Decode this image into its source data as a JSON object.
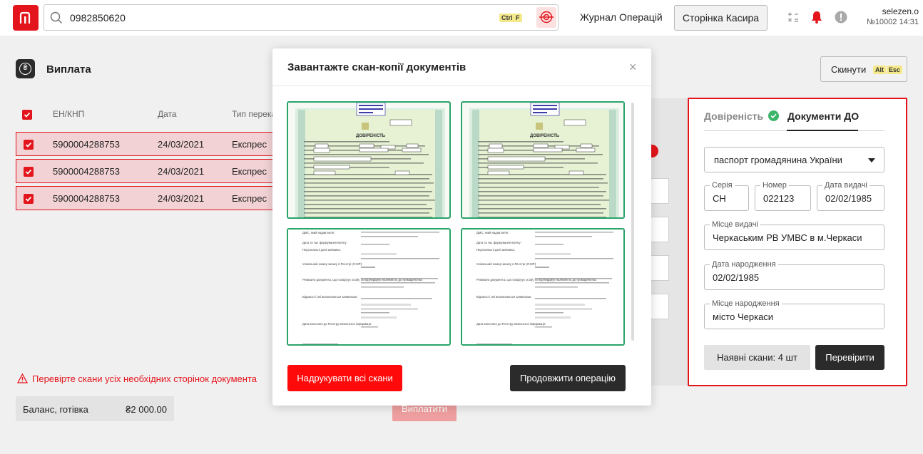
{
  "topbar": {
    "search_value": "0982850620",
    "search_kbd": [
      "Ctrl",
      "F"
    ],
    "journal_label": "Журнал Операцій",
    "cashier_label": "Сторінка Касира",
    "user_name": "selezen.o",
    "user_info": "№10002 14:31",
    "icons": [
      "logo-icon",
      "search-icon",
      "scanner-icon",
      "calculator-icon",
      "bell-icon",
      "alert-icon"
    ]
  },
  "page": {
    "title": "Виплата",
    "reset_label": "Скинути",
    "reset_kbd": [
      "Alt",
      "Esc"
    ],
    "columns": [
      "ЕН/КНП",
      "Дата",
      "Тип перека"
    ],
    "rows": [
      {
        "en": "5900004288753",
        "date": "24/03/2021",
        "type": "Експрес"
      },
      {
        "en": "5900004288753",
        "date": "24/03/2021",
        "type": "Експрес"
      },
      {
        "en": "5900004288753",
        "date": "24/03/2021",
        "type": "Експрес"
      }
    ],
    "warning": "Перевірте скани усіх необхідних сторінок документа",
    "balance_label": "Баланс, готівка",
    "balance_value": "₴2 000.00",
    "pay_label": "Виплатити"
  },
  "docs_panel": {
    "tab_trust": "Довіреність",
    "tab_docs": "Документи ДО",
    "doc_type": "паспорт громадянина України",
    "series_label": "Серія",
    "series_value": "СН",
    "number_label": "Номер",
    "number_value": "022123",
    "issue_date_label": "Дата видачі",
    "issue_date_value": "02/02/1985",
    "issue_place_label": "Місце видачі",
    "issue_place_value": "Черкаським РВ УМВС в м.Черкаси",
    "birth_date_label": "Дата народження",
    "birth_date_value": "02/02/1985",
    "birth_place_label": "Місце народження",
    "birth_place_value": "місто Черкаси",
    "scans_label": "Наявні скани: 4 шт",
    "verify_label": "Перевірити"
  },
  "modal": {
    "title": "Завантажте скан-копії документів",
    "close": "×",
    "print_label": "Надрукувати всі скани",
    "continue_label": "Продовжити операцію",
    "scans": [
      {
        "title": "ДОВІРЕНІСТЬ"
      },
      {
        "title": "ДОВІРЕНІСТЬ"
      },
      {
        "lines": [
          "ДМС, який надав витяг:",
          "Дата та час формування витягу:",
          "Персональні дані заявника:",
          "Унікальний номер запису в Реєстрі (УНЗР):",
          "Реквізити документа, що посвідчує особу та підтверджує належність до громадянства:",
          "Відомості, які визначаються заявником:",
          "Дата внесення до Реєстру визначеної інформації:"
        ]
      },
      {
        "lines": [
          "ДМС, який надав витяг:",
          "Дата та час формування витягу:",
          "Персональні дані заявника:",
          "Унікальний номер запису в Реєстрі (УНЗР):",
          "Реквізити документа, що посвідчує особу та підтверджує належність до громадянства:",
          "Відомості, які визначаються заявником:",
          "Дата внесення до Реєстру визначеної інформації:"
        ]
      }
    ]
  },
  "colors": {
    "brand_red": "#e3141b",
    "ok_green": "#3bb56a",
    "scan_border": "#2aa36a",
    "dark_button": "#2b2b2b"
  }
}
